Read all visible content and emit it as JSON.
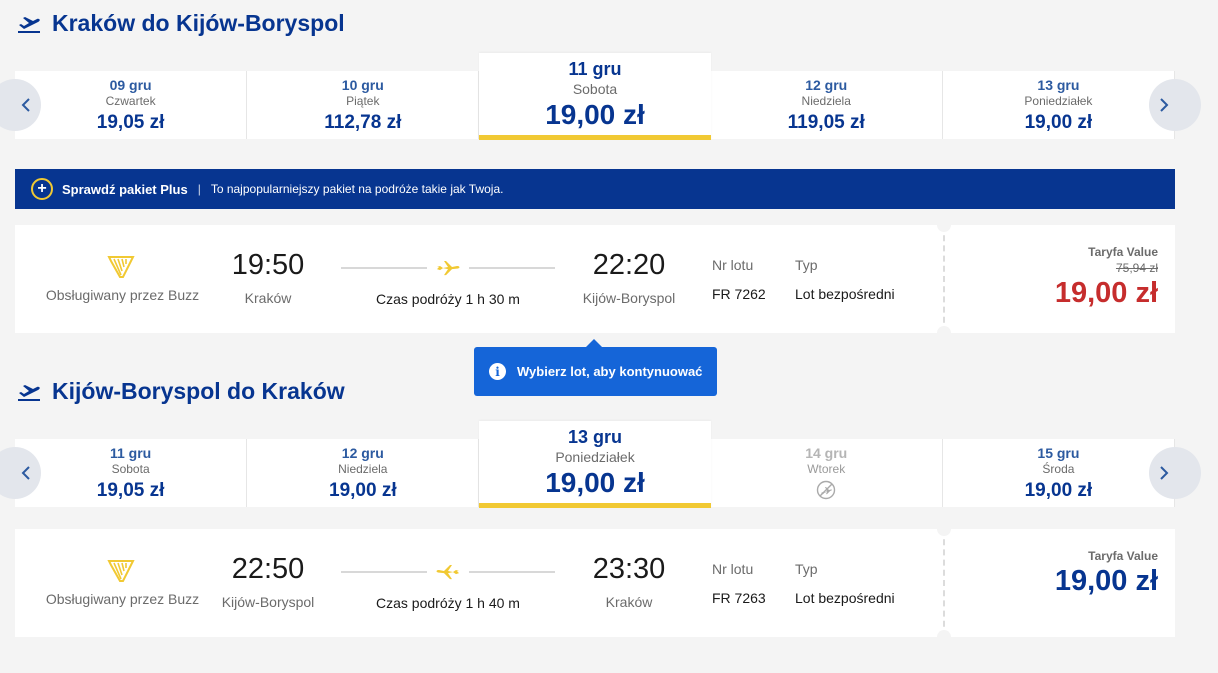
{
  "colors": {
    "brand_blue": "#073590",
    "accent_yellow": "#f1c933",
    "sale_red": "#c62d2d",
    "tooltip_blue": "#1565d8",
    "background": "#f4f4f4"
  },
  "outbound": {
    "title": "Kraków do Kijów-Boryspol",
    "title_icon": "plane-takeoff-icon",
    "dates": [
      {
        "date": "09 gru",
        "day": "Czwartek",
        "price": "19,05 zł"
      },
      {
        "date": "10 gru",
        "day": "Piątek",
        "price": "112,78 zł"
      },
      {
        "date": "11 gru",
        "day": "Sobota",
        "price": "19,00 zł",
        "selected": true
      },
      {
        "date": "12 gru",
        "day": "Niedziela",
        "price": "119,05 zł"
      },
      {
        "date": "13 gru",
        "day": "Poniedziałek",
        "price": "19,00 zł"
      }
    ],
    "flight": {
      "operator": "Obsługiwany przez Buzz",
      "dep_time": "19:50",
      "dep_city": "Kraków",
      "duration": "Czas podróży 1 h 30 m",
      "arr_time": "22:20",
      "arr_city": "Kijów-Boryspol",
      "flight_no_label": "Nr lotu",
      "flight_no": "FR 7262",
      "type_label": "Typ",
      "type": "Lot bezpośredni",
      "fare_label": "Taryfa Value",
      "fare_old": "75,94 zł",
      "fare_price": "19,00 zł"
    }
  },
  "promo": {
    "icon": "plus-circle-icon",
    "title": "Sprawdź pakiet Plus",
    "separator": "|",
    "text": "To najpopularniejszy pakiet na podróże takie jak Twoja."
  },
  "tooltip": {
    "icon": "info-icon",
    "text": "Wybierz lot, aby kontynuować"
  },
  "inbound": {
    "title": "Kijów-Boryspol do Kraków",
    "title_icon": "plane-takeoff-icon",
    "dates": [
      {
        "date": "11 gru",
        "day": "Sobota",
        "price": "19,05 zł"
      },
      {
        "date": "12 gru",
        "day": "Niedziela",
        "price": "19,00 zł"
      },
      {
        "date": "13 gru",
        "day": "Poniedziałek",
        "price": "19,00 zł",
        "selected": true
      },
      {
        "date": "14 gru",
        "day": "Wtorek",
        "price": "",
        "disabled": true
      },
      {
        "date": "15 gru",
        "day": "Środa",
        "price": "19,00 zł"
      }
    ],
    "flight": {
      "operator": "Obsługiwany przez Buzz",
      "dep_time": "22:50",
      "dep_city": "Kijów-Boryspol",
      "duration": "Czas podróży 1 h 40 m",
      "arr_time": "23:30",
      "arr_city": "Kraków",
      "flight_no_label": "Nr lotu",
      "flight_no": "FR 7263",
      "type_label": "Typ",
      "type": "Lot bezpośredni",
      "fare_label": "Taryfa Value",
      "fare_price": "19,00 zł"
    }
  }
}
